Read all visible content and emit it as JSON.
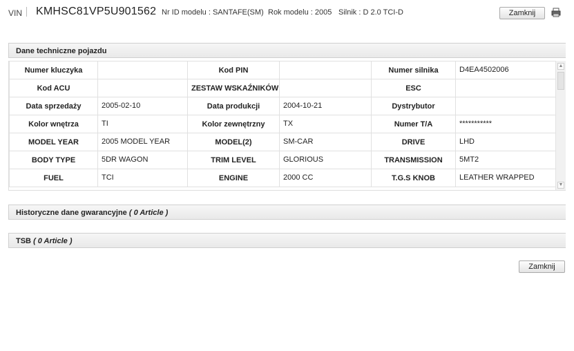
{
  "header": {
    "vin_label": "VIN",
    "vin_value": "KMHSC81VP5U901562",
    "model_id": "Nr ID modelu : SANTAFE(SM)",
    "model_year": "Rok modelu : 2005",
    "engine": "Silnik : D 2.0 TCI-D",
    "close_label": "Zamknij",
    "print_icon": "printer-icon"
  },
  "sections": {
    "tech": "Dane techniczne pojazdu",
    "warranty_title": "Historyczne dane gwarancyjne",
    "warranty_count": "( 0 Article )",
    "tsb_title": "TSB",
    "tsb_count": "( 0 Article )"
  },
  "spec_rows": [
    [
      "Numer kluczyka",
      "",
      "Kod PIN",
      "",
      "Numer silnika",
      "D4EA4502006"
    ],
    [
      "Kod ACU",
      "",
      "ZESTAW WSKAŹNIKÓW",
      "",
      "ESC",
      ""
    ],
    [
      "Data sprzedaży",
      "2005-02-10",
      "Data produkcji",
      "2004-10-21",
      "Dystrybutor",
      ""
    ],
    [
      "Kolor wnętrza",
      "TI",
      "Kolor zewnętrzny",
      "TX",
      "Numer T/A",
      "***********"
    ],
    [
      "MODEL YEAR",
      "2005 MODEL YEAR",
      "MODEL(2)",
      "SM-CAR",
      "DRIVE",
      "LHD"
    ],
    [
      "BODY TYPE",
      "5DR WAGON",
      "TRIM LEVEL",
      "GLORIOUS",
      "TRANSMISSION",
      "5MT2"
    ],
    [
      "FUEL",
      "TCI",
      "ENGINE",
      "2000 CC",
      "T.G.S KNOB",
      "LEATHER WRAPPED"
    ]
  ],
  "footer": {
    "close_label": "Zamknij"
  }
}
